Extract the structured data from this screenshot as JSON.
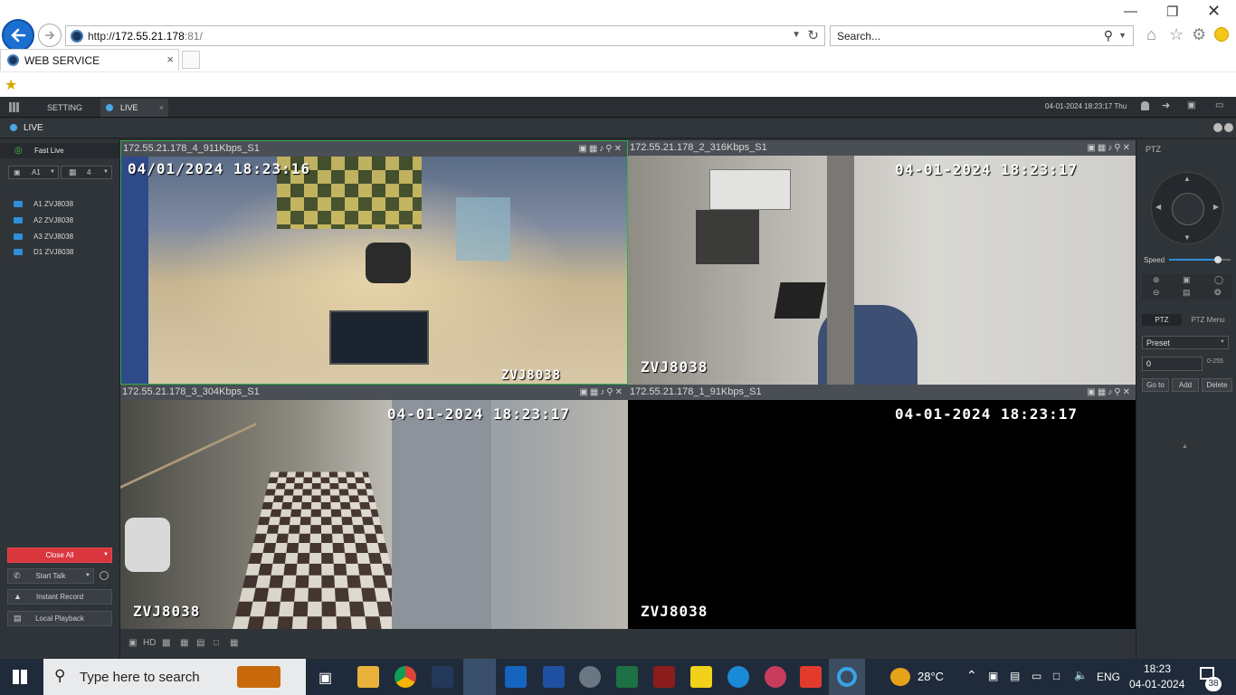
{
  "browser": {
    "url_prefix": "http://",
    "url_host": "172.55.21.178",
    "url_port": ":81/",
    "search_placeholder": "Search...",
    "tab_title": "WEB SERVICE",
    "tab_close": "×"
  },
  "app": {
    "tabs": [
      {
        "label": "SETTING"
      },
      {
        "label": "LIVE"
      }
    ],
    "tab_close": "×",
    "datetime": "04-01-2024 18:23:17 Thu",
    "live_title": "LIVE",
    "fast_live": "Fast Live",
    "channel_select": "A1",
    "split_select": "4",
    "devices": [
      "A1 ZVJ8038",
      "A2 ZVJ8038",
      "A3 ZVJ8038",
      "D1 ZVJ8038"
    ],
    "buttons": {
      "close_all": "Close All",
      "start_talk": "Start Talk",
      "instant_record": "Instant Record",
      "local_playback": "Local Playback"
    },
    "bottom_hd": "HD"
  },
  "panes": [
    {
      "header": "172.55.21.178_4_911Kbps_S1",
      "osd_time": "04/01/2024 18:23:16",
      "osd_name": "ZVJ8038"
    },
    {
      "header": "172.55.21.178_2_316Kbps_S1",
      "osd_time": "04-01-2024 18:23:17",
      "osd_name": "ZVJ8038"
    },
    {
      "header": "172.55.21.178_3_304Kbps_S1",
      "osd_time": "04-01-2024 18:23:17",
      "osd_name": "ZVJ8038"
    },
    {
      "header": "172.55.21.178_1_91Kbps_S1",
      "osd_time": "04-01-2024 18:23:17",
      "osd_name": "ZVJ8038"
    }
  ],
  "ptz": {
    "title": "PTZ",
    "speed_label": "Speed",
    "speed_level": 0.8,
    "tab_ptz": "PTZ",
    "tab_menu": "PTZ Menu",
    "preset_select": "Preset",
    "preset_value": "0",
    "preset_range": "0-255",
    "goto": "Go to",
    "add": "Add",
    "delete": "Delete"
  },
  "taskbar": {
    "search": "Type here to search",
    "weather": "28°C",
    "lang": "ENG",
    "time": "18:23",
    "date": "04-01-2024",
    "notif": "38"
  },
  "colors": {
    "accent": "#1b6fd1",
    "close_all": "#d9363e",
    "pane_active": "#2fb04a",
    "device_icon": "#2f8fd8"
  }
}
